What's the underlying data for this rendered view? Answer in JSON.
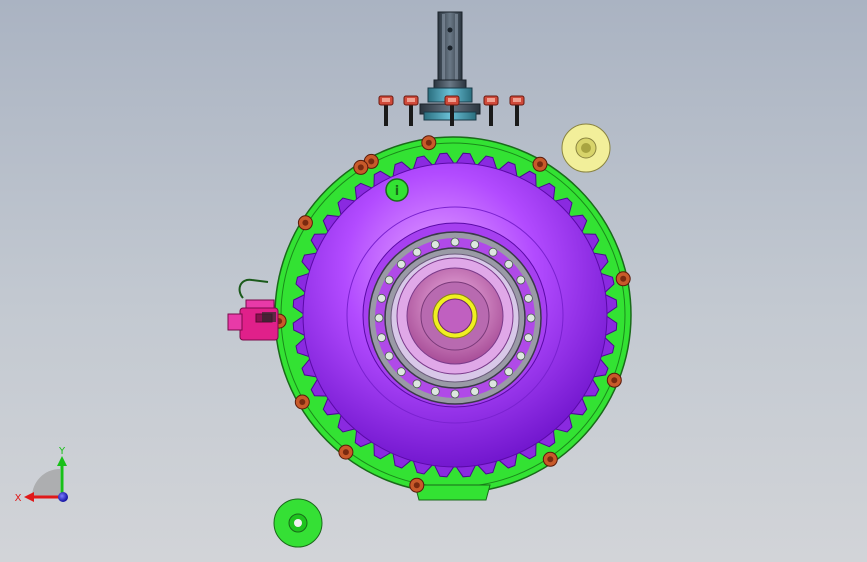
{
  "viewport": {
    "background_top": "#aab3c2",
    "background_bottom": "#d2d4d8"
  },
  "model": {
    "housing_color": "#33e233",
    "housing_edge": "#1a7a1a",
    "rotor_color": "#b24bff",
    "rotor_dark": "#7a14d6",
    "hub_color": "#c86bb0",
    "bearing_race_color": "#b8b0c8",
    "shaft_color": "#3a4652",
    "bolt_color": "#c85a2a",
    "connector_color": "#e0208a",
    "washer_yellow": "#f2ef9a",
    "washer_green": "#35e035"
  },
  "triad": {
    "x_label": "X",
    "y_label": "Y",
    "x_color": "#e01818",
    "y_color": "#18c018",
    "z_color": "#1818e0"
  }
}
